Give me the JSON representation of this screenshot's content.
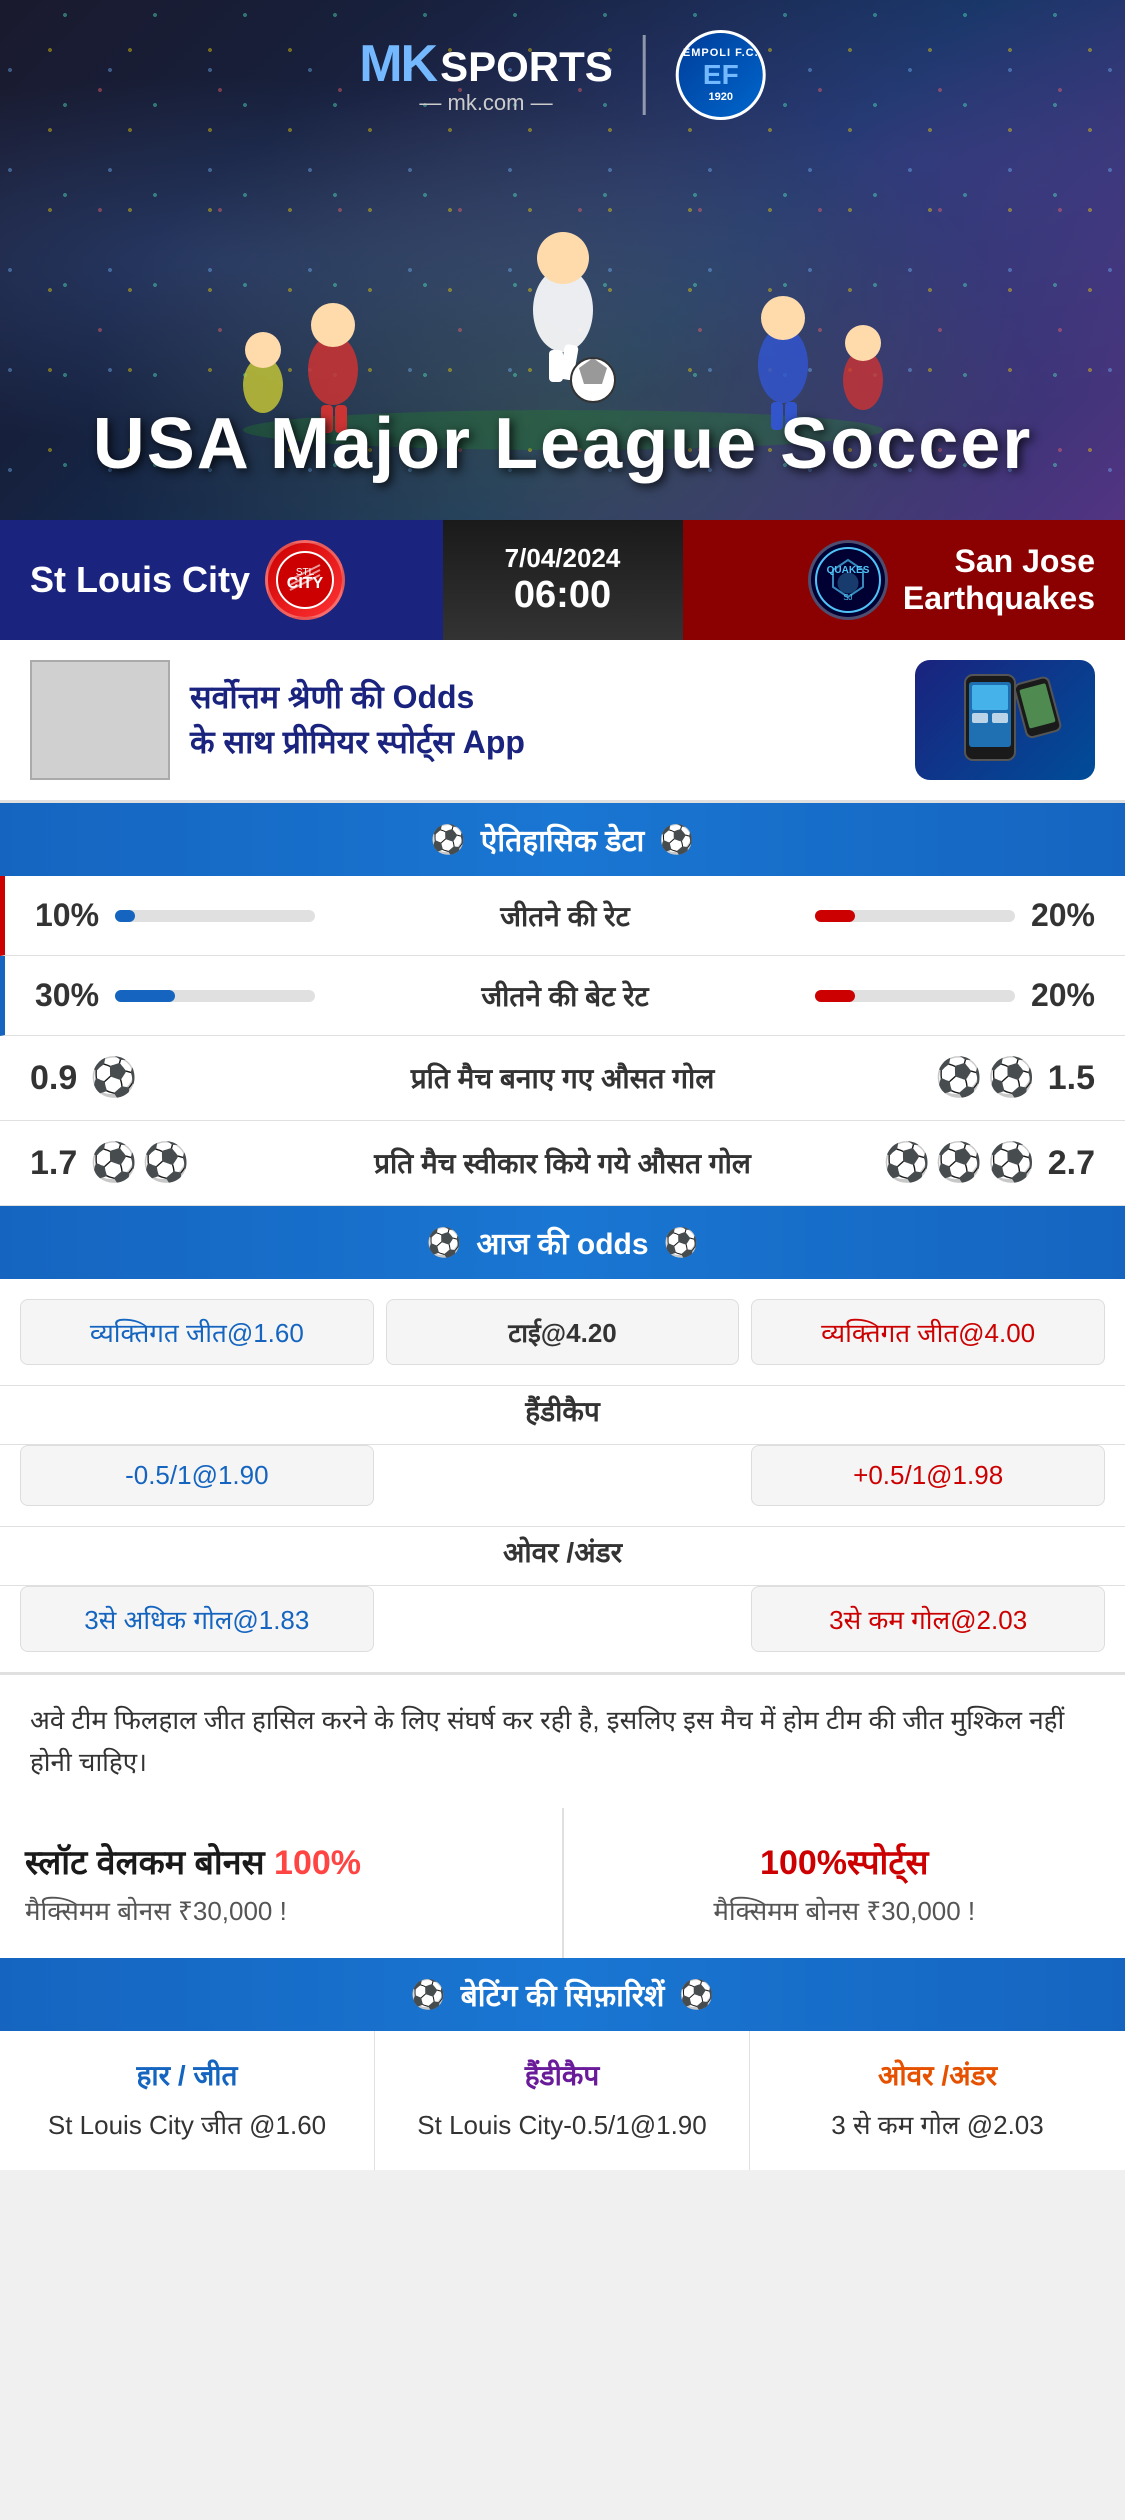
{
  "brand": {
    "mk": "MK",
    "sports": "SPORTS",
    "url": "mk.com",
    "divider": "|",
    "empoli_line1": "EMPOLI F.C.",
    "empoli_line2": "1920"
  },
  "hero": {
    "title": "USA Major League Soccer"
  },
  "match": {
    "home_team": "St Louis City",
    "date": "7/04/2024",
    "time": "06:00",
    "away_team": "San Jose\nEarthquakes",
    "away_label": "QUAKES"
  },
  "promo": {
    "text_line1": "सर्वोत्तम श्रेणी की Odds",
    "text_line2": "के साथ प्रीमियर स्पोर्ट्स App"
  },
  "historical": {
    "section_title": "ऐतिहासिक डेटा",
    "rows": [
      {
        "label": "जीतने की रेट",
        "left_val": "10%",
        "right_val": "20%",
        "left_pct": 10,
        "right_pct": 20
      },
      {
        "label": "जीतने की बेट रेट",
        "left_val": "30%",
        "right_val": "20%",
        "left_pct": 30,
        "right_pct": 20
      },
      {
        "label": "प्रति मैच बनाए गए औसत गोल",
        "left_val": "0.9",
        "right_val": "1.5",
        "left_balls": 1,
        "right_balls": 2
      },
      {
        "label": "प्रति मैच स्वीकार किये गये औसत गोल",
        "left_val": "1.7",
        "right_val": "2.7",
        "left_balls": 2,
        "right_balls": 3
      }
    ]
  },
  "odds": {
    "section_title": "आज की odds",
    "win_label": "व्यक्तिगत जीत@1.60",
    "tie_label": "टाई@4.20",
    "win_away_label": "व्यक्तिगत जीत@4.00",
    "handicap_home": "-0.5/1@1.90",
    "handicap_label": "हैंडीकैप",
    "handicap_away": "+0.5/1@1.98",
    "over_home": "3से अधिक गोल@1.83",
    "over_label": "ओवर /अंडर",
    "over_away": "3से कम गोल@2.03"
  },
  "note": {
    "text": "अवे टीम फिलहाल जीत हासिल करने के लिए संघर्ष कर रही है, इसलिए इस मैच में होम टीम की जीत मुश्किल नहीं होनी चाहिए।"
  },
  "bonus": {
    "left_title": "स्लॉट वेलकम बोनस",
    "left_highlight": "100%",
    "left_subtitle": "मैक्सिमम बोनस ₹30,000  !",
    "right_title": "100%स्पोर्ट्स",
    "right_subtitle": "मैक्सिमम बोनस  ₹30,000 !"
  },
  "betting": {
    "section_title": "बेटिंग की सिफ़ारिशें",
    "cols": [
      {
        "type": "हार / जीत",
        "result": "St Louis City जीत @1.60",
        "color": "blue"
      },
      {
        "type": "हैंडीकैप",
        "result": "St Louis City-0.5/1@1.90",
        "color": "purple"
      },
      {
        "type": "ओवर /अंडर",
        "result": "3 से कम गोल @2.03",
        "color": "orange"
      }
    ]
  }
}
